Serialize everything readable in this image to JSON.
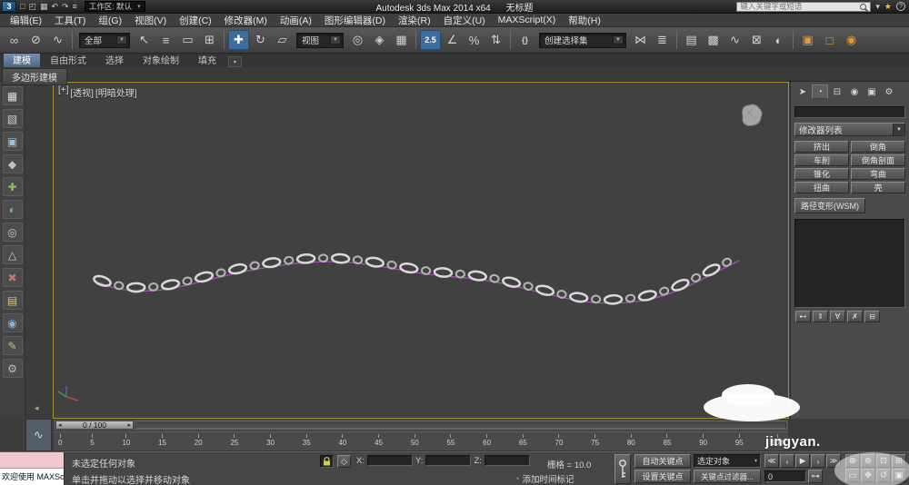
{
  "titlebar": {
    "logo_text": "3",
    "quick_access": [
      {
        "name": "new-scene-icon",
        "glyph": "□"
      },
      {
        "name": "open-scene-icon",
        "glyph": "◰"
      },
      {
        "name": "save-scene-icon",
        "glyph": "▦"
      },
      {
        "name": "undo-icon",
        "glyph": "↶"
      },
      {
        "name": "redo-icon",
        "glyph": "↷"
      },
      {
        "name": "scene-explorer-icon",
        "glyph": "≡"
      }
    ],
    "workspace_label": "工作区: 默认",
    "title": "Autodesk 3ds Max  2014 x64",
    "document_title": "无标题",
    "search_placeholder": "键入关键字或短语",
    "right_icons": [
      {
        "name": "sign-in-caret-icon",
        "glyph": "▾"
      },
      {
        "name": "favorites-star-icon",
        "glyph": "★",
        "star": true
      },
      {
        "name": "help-icon",
        "glyph": "?",
        "help": true
      }
    ]
  },
  "menubar": {
    "items": [
      {
        "id": "edit",
        "label": "编辑(E)"
      },
      {
        "id": "tools",
        "label": "工具(T)"
      },
      {
        "id": "group",
        "label": "组(G)"
      },
      {
        "id": "views",
        "label": "视图(V)"
      },
      {
        "id": "create",
        "label": "创建(C)"
      },
      {
        "id": "modifiers",
        "label": "修改器(M)"
      },
      {
        "id": "animation",
        "label": "动画(A)"
      },
      {
        "id": "graph-editors",
        "label": "图形编辑器(D)"
      },
      {
        "id": "rendering",
        "label": "渲染(R)"
      },
      {
        "id": "customize",
        "label": "自定义(U)"
      },
      {
        "id": "maxscript",
        "label": "MAXScript(X)"
      },
      {
        "id": "help",
        "label": "帮助(H)"
      }
    ]
  },
  "toolbar": {
    "items": [
      {
        "name": "select-and-link-icon",
        "glyph": "∞"
      },
      {
        "name": "unlink-selection-icon",
        "glyph": "⊘"
      },
      {
        "name": "bind-to-space-warp-icon",
        "glyph": "∿"
      },
      {
        "sep": true
      },
      {
        "name": "selection-filter-dropdown",
        "label": "全部",
        "dropdown": true,
        "width": 56
      },
      {
        "name": "select-object-icon",
        "glyph": "↖"
      },
      {
        "name": "select-by-name-icon",
        "glyph": "≡"
      },
      {
        "name": "rectangular-selection-icon",
        "glyph": "▭"
      },
      {
        "name": "window-crossing-icon",
        "glyph": "⊞"
      },
      {
        "sep": true
      },
      {
        "name": "select-and-move-icon",
        "glyph": "✚",
        "active": true
      },
      {
        "name": "select-and-rotate-icon",
        "glyph": "↻"
      },
      {
        "name": "select-and-scale-icon",
        "glyph": "▱"
      },
      {
        "name": "reference-coordinate-dropdown",
        "label": "视图",
        "dropdown": true,
        "width": 52
      },
      {
        "name": "use-pivot-center-icon",
        "glyph": "◎"
      },
      {
        "name": "select-and-manipulate-icon",
        "glyph": "◈"
      },
      {
        "name": "keyboard-override-icon",
        "glyph": "▦"
      },
      {
        "sep": true
      },
      {
        "name": "snaps-toggle-icon",
        "glyph": "2.5",
        "active": true,
        "text": true
      },
      {
        "name": "angle-snap-icon",
        "glyph": "∠"
      },
      {
        "name": "percent-snap-icon",
        "glyph": "%"
      },
      {
        "name": "spinner-snap-icon",
        "glyph": "⇅"
      },
      {
        "sep": true
      },
      {
        "name": "edit-named-selections-icon",
        "glyph": "{}",
        "text": true
      },
      {
        "name": "named-selection-dropdown",
        "label": "创建选择集",
        "dropdown": true,
        "width": 96
      },
      {
        "name": "mirror-icon",
        "glyph": "⋈"
      },
      {
        "name": "align-icon",
        "glyph": "≣"
      },
      {
        "sep": true
      },
      {
        "name": "layer-manager-icon",
        "glyph": "▤"
      },
      {
        "name": "graphite-ribbon-icon",
        "glyph": "▩"
      },
      {
        "name": "curve-editor-icon",
        "glyph": "∿"
      },
      {
        "name": "schematic-view-icon",
        "glyph": "⊠"
      },
      {
        "name": "material-editor-icon",
        "glyph": "◐"
      },
      {
        "sep": true
      },
      {
        "name": "render-setup-icon",
        "glyph": "▣",
        "hot": true
      },
      {
        "name": "rendered-frame-window-icon",
        "glyph": "□",
        "hot": true
      },
      {
        "name": "render-production-icon",
        "glyph": "◉",
        "hot": true
      }
    ]
  },
  "ribbon": {
    "tabs": [
      {
        "id": "modeling",
        "label": "建模",
        "active": true
      },
      {
        "id": "freeform",
        "label": "自由形式"
      },
      {
        "id": "selection",
        "label": "选择"
      },
      {
        "id": "object-paint",
        "label": "对象绘制"
      },
      {
        "id": "populate",
        "label": "填充"
      }
    ],
    "panel_tab": "多边形建模"
  },
  "left_toolbar": {
    "items": [
      {
        "name": "polygon-modeling-icon",
        "glyph": "▦",
        "color": "#d4dade"
      },
      {
        "name": "edit-poly-mode-icon",
        "glyph": "▧",
        "color": "#c8ced4"
      },
      {
        "name": "modify-selection-icon",
        "glyph": "▣",
        "color": "#9cc4e0"
      },
      {
        "name": "geometry-icon",
        "glyph": "◆",
        "color": "#b8c0c8"
      },
      {
        "name": "add-geometry-icon",
        "glyph": "✚",
        "color": "#86c05e"
      },
      {
        "name": "subdivision-icon",
        "glyph": "◐",
        "color": "#74b0d8"
      },
      {
        "name": "loops-icon",
        "glyph": "◎",
        "color": "#c4ccd4"
      },
      {
        "name": "triangles-icon",
        "glyph": "△",
        "color": "#c8c8c8"
      },
      {
        "name": "remove-geometry-icon",
        "glyph": "✖",
        "color": "#d07070"
      },
      {
        "name": "properties-icon",
        "glyph": "▤",
        "color": "#d4c470"
      },
      {
        "name": "visibility-icon",
        "glyph": "◉",
        "color": "#88b4d8"
      },
      {
        "name": "paint-deform-icon",
        "glyph": "✎",
        "color": "#ccb890"
      },
      {
        "name": "settings-gear-icon",
        "glyph": "⚙",
        "color": "#bcbcbc"
      }
    ]
  },
  "viewport": {
    "label_add": "[+]",
    "label_view": "[透视]",
    "label_shading": "[明暗处理]"
  },
  "command_panel": {
    "tabs": [
      {
        "name": "create-tab-icon",
        "glyph": "➤"
      },
      {
        "name": "modify-tab-icon",
        "glyph": "◔",
        "active": true
      },
      {
        "name": "hierarchy-tab-icon",
        "glyph": "⊟"
      },
      {
        "name": "motion-tab-icon",
        "glyph": "◉"
      },
      {
        "name": "display-tab-icon",
        "glyph": "▣"
      },
      {
        "name": "utilities-tab-icon",
        "glyph": "⚙"
      }
    ],
    "object_name": "",
    "modifier_list_label": "修改器列表",
    "modifier_buttons": [
      {
        "id": "extrude",
        "label": "挤出"
      },
      {
        "id": "bevel",
        "label": "倒角"
      },
      {
        "id": "lathe",
        "label": "车削"
      },
      {
        "id": "bevel-profile",
        "label": "倒角剖面"
      },
      {
        "id": "taper",
        "label": "锥化"
      },
      {
        "id": "bend",
        "label": "弯曲"
      },
      {
        "id": "twist",
        "label": "扭曲"
      },
      {
        "id": "shell",
        "label": "壳"
      }
    ],
    "path_deform_button": "路径变形(WSM)",
    "stack_buttons": [
      {
        "name": "pin-stack-icon",
        "glyph": "⊷"
      },
      {
        "name": "show-end-result-icon",
        "glyph": "‖"
      },
      {
        "name": "make-unique-icon",
        "glyph": "∀"
      },
      {
        "name": "remove-modifier-icon",
        "glyph": "✗"
      },
      {
        "name": "configure-modifier-sets-icon",
        "glyph": "⊟"
      }
    ]
  },
  "time_slider": {
    "value": "0 / 100"
  },
  "timeline": {
    "ticks": [
      "0",
      "5",
      "10",
      "15",
      "20",
      "25",
      "30",
      "35",
      "40",
      "45",
      "50",
      "55",
      "60",
      "65",
      "70",
      "75",
      "80",
      "85",
      "90",
      "95",
      "100"
    ]
  },
  "status_bar": {
    "selection_status": "未选定任何对象",
    "prompt": "单击并拖动以选择并移动对象",
    "grid_label": "栅格 = 10.0",
    "x_label": "X:",
    "y_label": "Y:",
    "z_label": "Z:"
  },
  "animation": {
    "add_time_tag": "添加时间标记",
    "auto_key": "自动关键点",
    "set_key": "设置关键点",
    "key_filter_scope": "选定对象",
    "key_filters": "关键点过滤器...",
    "frame_value": "0",
    "playback": [
      {
        "name": "go-to-start-icon",
        "glyph": "≪"
      },
      {
        "name": "previous-frame-icon",
        "glyph": "‹"
      },
      {
        "name": "play-animation-icon",
        "glyph": "▶"
      },
      {
        "name": "next-frame-icon",
        "glyph": "›"
      },
      {
        "name": "go-to-end-icon",
        "glyph": "≫"
      }
    ]
  },
  "navigation": {
    "items": [
      {
        "name": "zoom-icon",
        "glyph": "⊕"
      },
      {
        "name": "zoom-all-icon",
        "glyph": "⊚"
      },
      {
        "name": "zoom-extents-icon",
        "glyph": "⊡"
      },
      {
        "name": "zoom-extents-all-icon",
        "glyph": "⊞"
      },
      {
        "name": "zoom-region-icon",
        "glyph": "▭"
      },
      {
        "name": "pan-icon",
        "glyph": "✥"
      },
      {
        "name": "orbit-icon",
        "glyph": "↺"
      },
      {
        "name": "maximize-viewport-icon",
        "glyph": "▣"
      }
    ]
  },
  "maxscript": {
    "listener_text": "欢迎使用 MAXScript"
  },
  "watermark": {
    "text": "jingyan."
  }
}
